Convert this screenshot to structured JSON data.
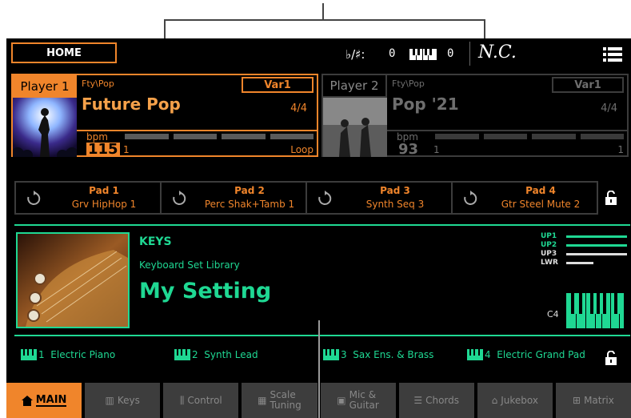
{
  "topbar": {
    "home_label": "HOME",
    "transpose_label": "♭/♯:",
    "transpose_value": "0",
    "keyboard_transpose_value": "0",
    "chord": "N.C."
  },
  "players": [
    {
      "tab_label": "Player 1",
      "style_path": "Fty\\Pop",
      "variation": "Var1",
      "style_name": "Future Pop",
      "meter": "4/4",
      "bpm_label": "bpm",
      "bpm": "115",
      "beat": "1",
      "mode": "Loop",
      "active": true
    },
    {
      "tab_label": "Player 2",
      "style_path": "Fty\\Pop",
      "variation": "Var1",
      "style_name": "Pop '21",
      "meter": "4/4",
      "bpm_label": "bpm",
      "bpm": "93",
      "beat": "1",
      "mode": "1",
      "active": false
    }
  ],
  "pads": [
    {
      "name": "Pad 1",
      "sound": "Grv HipHop 1"
    },
    {
      "name": "Pad 2",
      "sound": "Perc Shak+Tamb 1"
    },
    {
      "name": "Pad 3",
      "sound": "Synth Seq 3"
    },
    {
      "name": "Pad 4",
      "sound": "Gtr Steel Mute 2"
    }
  ],
  "keyboard_set": {
    "category": "KEYS",
    "library": "Keyboard Set Library",
    "name": "My Setting",
    "octave": "C4",
    "layers": [
      {
        "label": "UP1",
        "active": true
      },
      {
        "label": "UP2",
        "active": true
      },
      {
        "label": "UP3",
        "active": false
      },
      {
        "label": "LWR",
        "active": false
      }
    ]
  },
  "sounds": [
    {
      "number": "1",
      "name": "Electric Piano"
    },
    {
      "number": "2",
      "name": "Synth Lead"
    },
    {
      "number": "3",
      "name": "Sax Ens. & Brass"
    },
    {
      "number": "4",
      "name": "Electric Grand Pad"
    }
  ],
  "tabs": [
    {
      "label": "MAIN",
      "icon": "home-icon",
      "active": true
    },
    {
      "label": "Keys",
      "icon": "keys-icon",
      "active": false
    },
    {
      "label": "Control",
      "icon": "control-icon",
      "active": false
    },
    {
      "label1": "Scale",
      "label2": "Tuning",
      "icon": "scale-icon",
      "active": false
    },
    {
      "label1": "Mic &",
      "label2": "Guitar",
      "icon": "mic-icon",
      "active": false
    },
    {
      "label": "Chords",
      "icon": "chords-icon",
      "active": false
    },
    {
      "label": "Jukebox",
      "icon": "jukebox-icon",
      "active": false
    },
    {
      "label": "Matrix",
      "icon": "matrix-icon",
      "active": false
    }
  ],
  "colors": {
    "accent": "#f0852b",
    "keyboard_green": "#1fd893",
    "inactive": "#3d3d3d"
  }
}
